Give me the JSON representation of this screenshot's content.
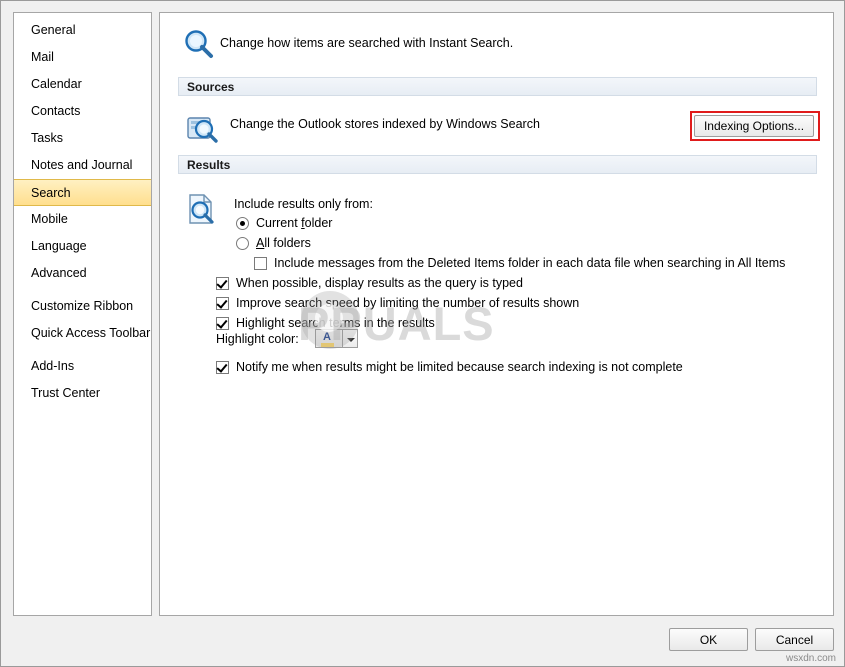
{
  "sidebar": {
    "items": [
      {
        "label": "General",
        "selected": false
      },
      {
        "label": "Mail",
        "selected": false
      },
      {
        "label": "Calendar",
        "selected": false
      },
      {
        "label": "Contacts",
        "selected": false
      },
      {
        "label": "Tasks",
        "selected": false
      },
      {
        "label": "Notes and Journal",
        "selected": false
      },
      {
        "label": "Search",
        "selected": true
      },
      {
        "label": "Mobile",
        "selected": false
      },
      {
        "label": "Language",
        "selected": false
      },
      {
        "label": "Advanced",
        "selected": false
      },
      {
        "label": "Customize Ribbon",
        "selected": false
      },
      {
        "label": "Quick Access Toolbar",
        "selected": false
      },
      {
        "label": "Add-Ins",
        "selected": false
      },
      {
        "label": "Trust Center",
        "selected": false
      }
    ]
  },
  "header": {
    "text": "Change how items are searched with Instant Search.",
    "icon": "magnifier-icon"
  },
  "sources": {
    "title": "Sources",
    "description": "Change the Outlook stores indexed by Windows Search",
    "button_label": "Indexing Options...",
    "icon": "search-store-icon",
    "highlight_color": "#e01b1b"
  },
  "results": {
    "title": "Results",
    "icon": "results-search-icon",
    "include_label": "Include results only from:",
    "radios": [
      {
        "label": "Current folder",
        "checked": true,
        "underline_char": "f"
      },
      {
        "label": "All folders",
        "checked": false,
        "underline_char": "A"
      }
    ],
    "deleted_items_checkbox": {
      "label": "Include messages from the Deleted Items folder in each data file when searching in All Items",
      "checked": false
    },
    "checkboxes": [
      {
        "label": "When possible, display results as the query is typed",
        "checked": true
      },
      {
        "label": "Improve search speed by limiting the number of results shown",
        "checked": true
      },
      {
        "label": "Highlight search terms in the results",
        "checked": true
      }
    ],
    "highlight_color_label": "Highlight color:",
    "highlight_color_value": "#ffd966",
    "notify_checkbox": {
      "label": "Notify me when results might be limited because search indexing is not complete",
      "checked": true
    }
  },
  "footer": {
    "ok_label": "OK",
    "cancel_label": "Cancel"
  },
  "watermark": {
    "text": "PPUALS",
    "url": "wsxdn.com"
  }
}
